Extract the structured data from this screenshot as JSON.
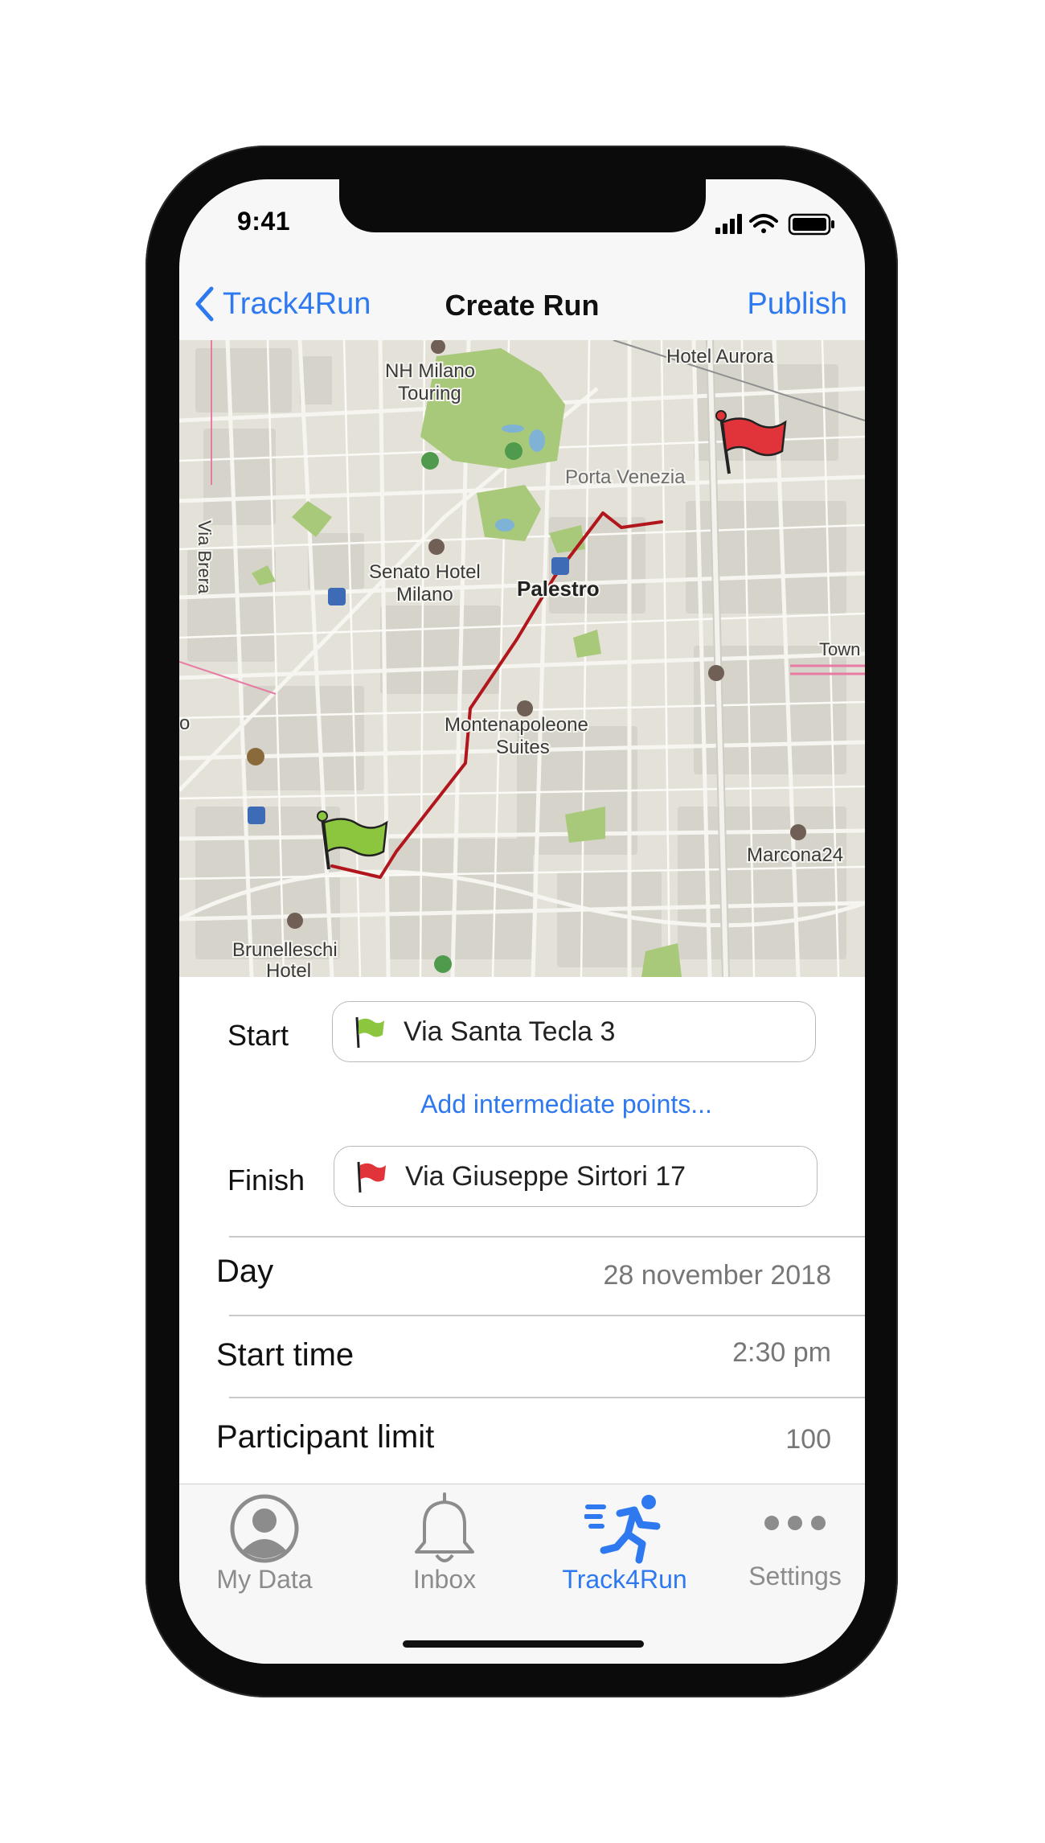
{
  "status_bar": {
    "time": "9:41"
  },
  "nav": {
    "back_label": "Track4Run",
    "title": "Create Run",
    "action_label": "Publish"
  },
  "map": {
    "labels": {
      "hotel_aurora": "Hotel Aurora",
      "nh_milano_1": "NH Milano",
      "nh_milano_2": "Touring",
      "porta_venezia": "Porta Venezia",
      "via_brera": "Via Brera",
      "senato_1": "Senato Hotel",
      "senato_2": "Milano",
      "palestro": "Palestro",
      "town": "Town",
      "montenapoleone_1": "Montenapoleone",
      "montenapoleone_2": "Suites",
      "marcona": "Marcona24",
      "brunelleschi_1": "Brunelleschi",
      "brunelleschi_2": "Hotel",
      "edge_o": "o"
    },
    "route_color": "#b0161c",
    "start_flag_color": "#8cc63f",
    "finish_flag_color": "#e0333a"
  },
  "form": {
    "start_label": "Start",
    "start_value": "Via Santa Tecla 3",
    "add_points": "Add intermediate points...",
    "finish_label": "Finish",
    "finish_value": "Via Giuseppe Sirtori 17",
    "rows": [
      {
        "label": "Day",
        "value": "28 november 2018"
      },
      {
        "label": "Start time",
        "value": "2:30 pm"
      },
      {
        "label": "Participant limit",
        "value": "100"
      }
    ]
  },
  "tabs": [
    {
      "label": "My Data",
      "icon": "person-circle-icon",
      "active": false
    },
    {
      "label": "Inbox",
      "icon": "bell-icon",
      "active": false
    },
    {
      "label": "Track4Run",
      "icon": "runner-icon",
      "active": true
    },
    {
      "label": "Settings",
      "icon": "ellipsis-icon",
      "active": false
    }
  ],
  "colors": {
    "accent": "#2f79f0",
    "route": "#b0161c",
    "park": "#a9c97a"
  }
}
